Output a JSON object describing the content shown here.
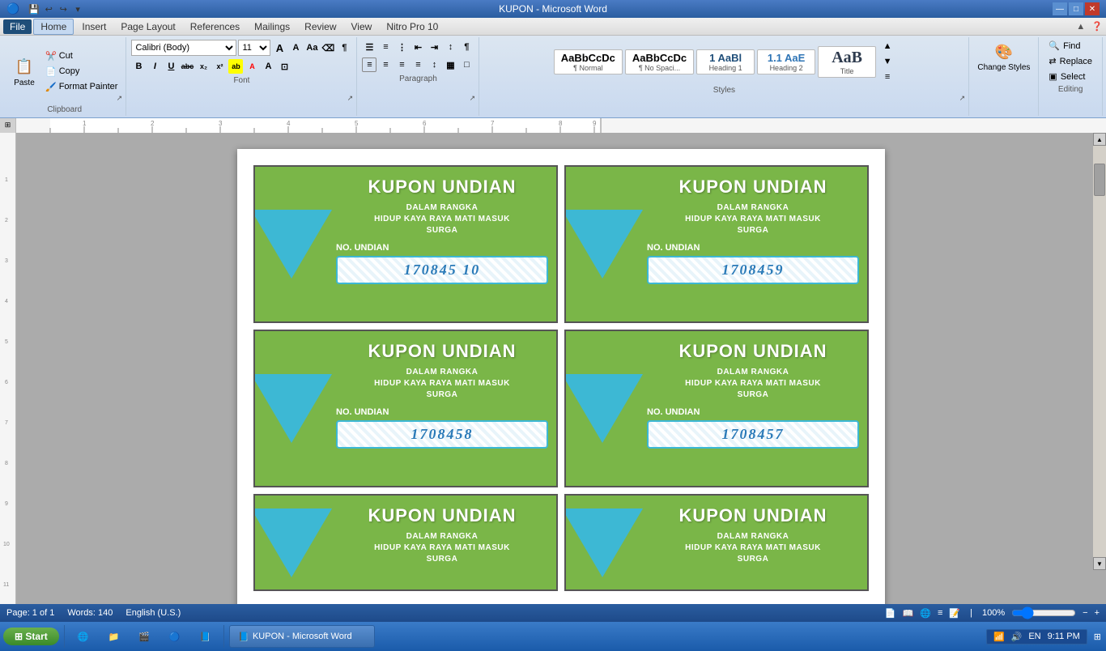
{
  "titlebar": {
    "title": "KUPON - Microsoft Word",
    "min": "—",
    "max": "□",
    "close": "✕"
  },
  "quickaccess": {
    "buttons": [
      "💾",
      "↩",
      "↪"
    ]
  },
  "menutabs": {
    "items": [
      "File",
      "Home",
      "Insert",
      "Page Layout",
      "References",
      "Mailings",
      "Review",
      "View",
      "Nitro Pro 10"
    ]
  },
  "ribbon": {
    "clipboard": {
      "label": "Clipboard",
      "paste": "Paste",
      "cut": "Cut",
      "copy": "Copy",
      "format_painter": "Format Painter"
    },
    "font": {
      "label": "Font",
      "name": "Calibri (Body)",
      "size": "11",
      "bold": "B",
      "italic": "I",
      "underline": "U",
      "strikethrough": "abc",
      "subscript": "x₂",
      "superscript": "x²"
    },
    "paragraph": {
      "label": "Paragraph"
    },
    "styles": {
      "label": "Styles",
      "items": [
        {
          "label": "¶ Normal",
          "preview": "AaBbCcDc",
          "color": "#000"
        },
        {
          "label": "¶ No Spaci...",
          "preview": "AaBbCcDc",
          "color": "#000"
        },
        {
          "label": "Heading 1",
          "preview": "1 AaBl",
          "color": "#1f4e79"
        },
        {
          "label": "Heading 2",
          "preview": "1.1 AaE",
          "color": "#2e74b5"
        },
        {
          "label": "Title",
          "preview": "AaB",
          "color": "#000"
        }
      ]
    },
    "change_styles": {
      "label": "Change Styles"
    },
    "editing": {
      "label": "Editing",
      "find": "Find",
      "replace": "Replace",
      "select": "Select"
    }
  },
  "document": {
    "coupons": [
      {
        "title": "KUPON UNDIAN",
        "line1": "DALAM RANGKA",
        "line2": "HIDUP KAYA RAYA MATI MASUK",
        "line3": "SURGA",
        "no_label": "NO. UNDIAN",
        "number": "170845  10"
      },
      {
        "title": "KUPON UNDIAN",
        "line1": "DALAM RANGKA",
        "line2": "HIDUP KAYA RAYA MATI MASUK",
        "line3": "SURGA",
        "no_label": "NO. UNDIAN",
        "number": "1708459"
      },
      {
        "title": "KUPON UNDIAN",
        "line1": "DALAM RANGKA",
        "line2": "HIDUP KAYA RAYA MATI MASUK",
        "line3": "SURGA",
        "no_label": "NO. UNDIAN",
        "number": "1708458"
      },
      {
        "title": "KUPON UNDIAN",
        "line1": "DALAM RANGKA",
        "line2": "HIDUP KAYA RAYA MATI MASUK",
        "line3": "SURGA",
        "no_label": "NO. UNDIAN",
        "number": "1708457"
      },
      {
        "title": "KUPON UNDIAN",
        "line1": "DALAM RANGKA",
        "line2": "HIDUP KAYA RAYA MATI MASUK",
        "line3": "SURGA",
        "no_label": "",
        "number": ""
      },
      {
        "title": "KUPON UNDIAN",
        "line1": "DALAM RANGKA",
        "line2": "HIDUP KAYA RAYA MATI MASUK",
        "line3": "SURGA",
        "no_label": "",
        "number": ""
      }
    ]
  },
  "statusbar": {
    "page": "Page: 1 of 1",
    "words": "Words: 140",
    "language": "English (U.S.)",
    "zoom": "100%"
  },
  "taskbar": {
    "time": "9:11 PM",
    "language": "EN",
    "doc_title": "KUPON - Microsoft Word"
  }
}
